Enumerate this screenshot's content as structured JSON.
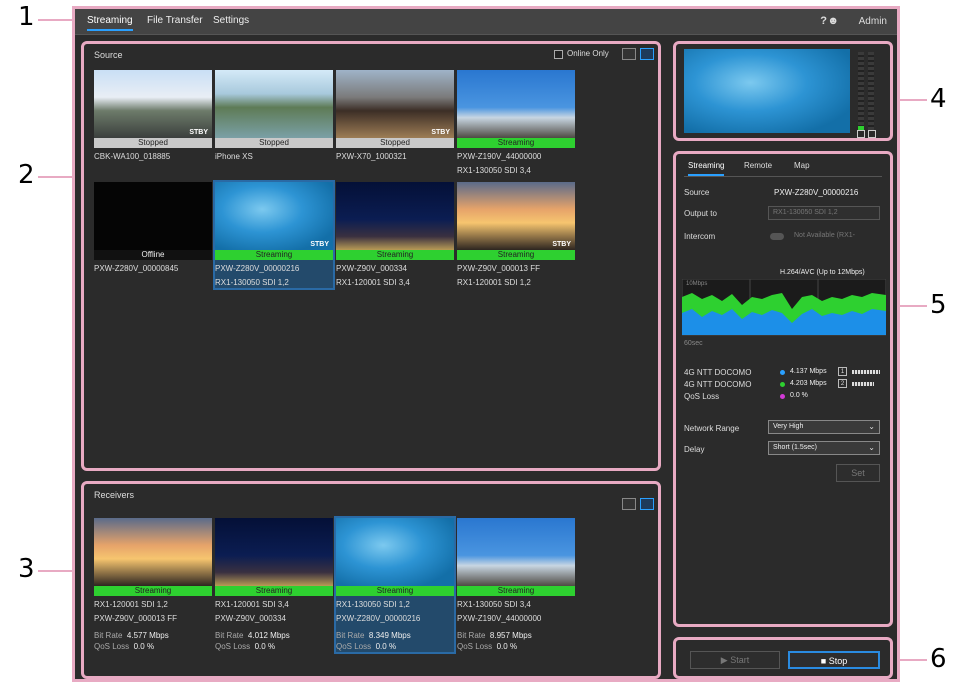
{
  "callouts": {
    "c1": "1",
    "c2": "2",
    "c3": "3",
    "c4": "4",
    "c5": "5",
    "c6": "6"
  },
  "topbar": {
    "tabs": [
      "Streaming",
      "File Transfer",
      "Settings"
    ],
    "help": "?",
    "admin": "Admin"
  },
  "source": {
    "title": "Source",
    "online_only": "Online Only",
    "tiles": [
      {
        "status": "Stopped",
        "name1": "CBK-WA100_018885",
        "name2": "",
        "stby": "STBY",
        "scene": "train"
      },
      {
        "status": "Stopped",
        "name1": "iPhone XS",
        "name2": "",
        "stby": "",
        "scene": "mountain"
      },
      {
        "status": "Stopped",
        "name1": "PXW-X70_1000321",
        "name2": "",
        "stby": "STBY",
        "scene": "rail"
      },
      {
        "status": "Streaming",
        "name1": "PXW-Z190V_44000000",
        "name2": "RX1-130050 SDI 3,4",
        "stby": "",
        "scene": "birds"
      },
      {
        "status": "Offline",
        "name1": "PXW-Z280V_00000845",
        "name2": "",
        "stby": "",
        "scene": "black"
      },
      {
        "status": "Streaming",
        "name1": "PXW-Z280V_00000216",
        "name2": "RX1-130050 SDI 1,2",
        "stby": "STBY",
        "scene": "dolphin"
      },
      {
        "status": "Streaming",
        "name1": "PXW-Z90V_000334",
        "name2": "RX1-120001 SDI 3,4",
        "stby": "",
        "scene": "ferris"
      },
      {
        "status": "Streaming",
        "name1": "PXW-Z90V_000013 FF",
        "name2": "RX1-120001 SDI 1,2",
        "stby": "STBY",
        "scene": "sunset"
      }
    ]
  },
  "receivers": {
    "title": "Receivers",
    "tiles": [
      {
        "status": "Streaming",
        "name1": "RX1-120001 SDI 1,2",
        "name2": "PXW-Z90V_000013 FF",
        "bit_rate_label": "Bit Rate",
        "bit_rate": "4.577 Mbps",
        "qos_label": "QoS Loss",
        "qos": "0.0 %",
        "scene": "sunset"
      },
      {
        "status": "Streaming",
        "name1": "RX1-120001 SDI 3,4",
        "name2": "PXW-Z90V_000334",
        "bit_rate_label": "Bit Rate",
        "bit_rate": "4.012 Mbps",
        "qos_label": "QoS Loss",
        "qos": "0.0 %",
        "scene": "ferris"
      },
      {
        "status": "Streaming",
        "name1": "RX1-130050 SDI 1,2",
        "name2": "PXW-Z280V_00000216",
        "bit_rate_label": "Bit Rate",
        "bit_rate": "8.349 Mbps",
        "qos_label": "QoS Loss",
        "qos": "0.0 %",
        "scene": "dolphin"
      },
      {
        "status": "Streaming",
        "name1": "RX1-130050 SDI 3,4",
        "name2": "PXW-Z190V_44000000",
        "bit_rate_label": "Bit Rate",
        "bit_rate": "8.957 Mbps",
        "qos_label": "QoS Loss",
        "qos": "0.0 %",
        "scene": "birds"
      }
    ]
  },
  "right_panel": {
    "tabs": [
      "Streaming",
      "Remote",
      "Map"
    ],
    "source_label": "Source",
    "source_value": "PXW-Z280V_00000216",
    "output_label": "Output to",
    "output_value": "RX1-130050 SDI 1,2",
    "intercom_label": "Intercom",
    "intercom_value": "Not Available (RX1-",
    "graph_title": "H.264/AVC (Up to 12Mbps)",
    "graph_ymax": "10Mbps",
    "graph_xlabel": "60sec",
    "carriers": [
      {
        "name": "4G NTT DOCOMO",
        "value": "4.137 Mbps",
        "num": "1",
        "color": "#2aa0ff"
      },
      {
        "name": "4G NTT DOCOMO",
        "value": "4.203 Mbps",
        "num": "2",
        "color": "#2ed030"
      }
    ],
    "qos_label": "QoS Loss",
    "qos_value": "0.0 %",
    "qos_color": "#d23ad6",
    "network_label": "Network Range",
    "network_value": "Very High",
    "delay_label": "Delay",
    "delay_value": "Short (1.5sec)",
    "set_label": "Set"
  },
  "controls": {
    "start": "Start",
    "stop": "Stop"
  }
}
